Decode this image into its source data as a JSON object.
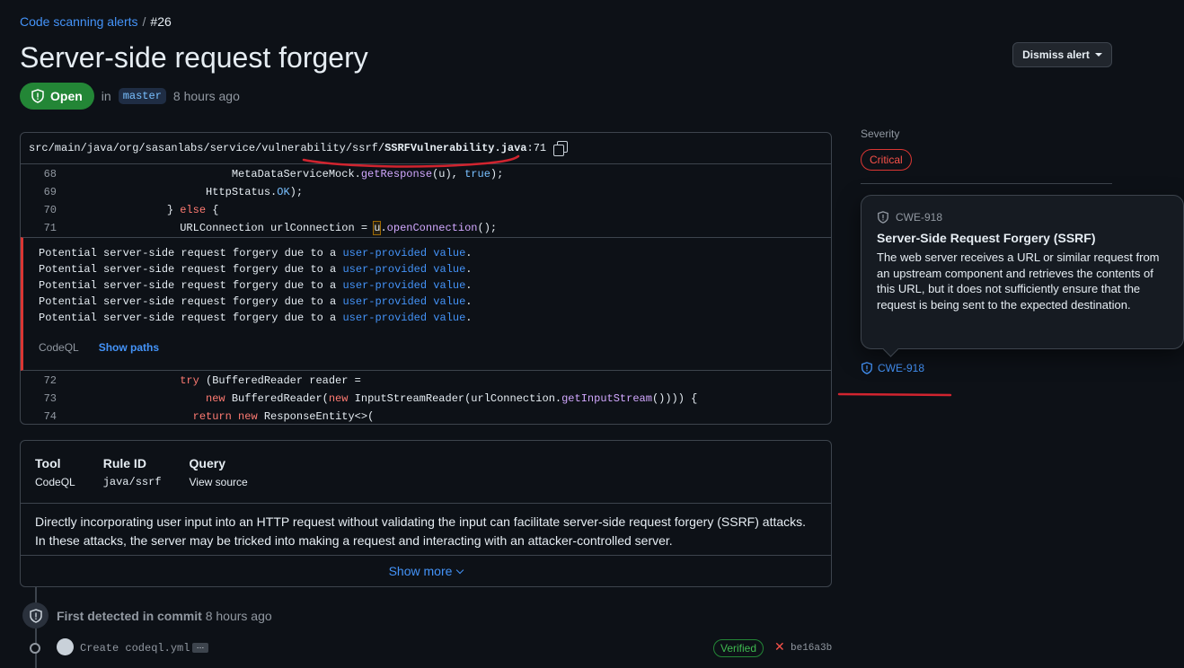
{
  "breadcrumb": {
    "link": "Code scanning alerts",
    "current": "#26"
  },
  "title": "Server-side request forgery",
  "dismiss_label": "Dismiss alert",
  "status": {
    "badge": "Open",
    "in_text": "in",
    "branch": "master",
    "time": "8 hours ago"
  },
  "file": {
    "path": "src/main/java/org/sasanlabs/service/vulnerability/ssrf/",
    "name": "SSRFVulnerability.java",
    "line": ":71"
  },
  "code_before": [
    {
      "n": "68",
      "indent": "                        ",
      "parts": [
        [
          "MetaDataServiceMock.",
          ""
        ],
        [
          "getResponse",
          "fn"
        ],
        [
          "(u), ",
          ""
        ],
        [
          "true",
          "cs"
        ],
        [
          ");",
          ""
        ]
      ]
    },
    {
      "n": "69",
      "indent": "                    ",
      "parts": [
        [
          "HttpStatus.",
          ""
        ],
        [
          "OK",
          "cs"
        ],
        [
          ");",
          ""
        ]
      ]
    },
    {
      "n": "70",
      "indent": "              ",
      "parts": [
        [
          "} ",
          ""
        ],
        [
          "else",
          "kw"
        ],
        [
          " {",
          ""
        ]
      ]
    },
    {
      "n": "71",
      "indent": "                ",
      "parts": [
        [
          "URLConnection urlConnection = ",
          ""
        ],
        [
          "u",
          "hl"
        ],
        [
          ".",
          ""
        ],
        [
          "openConnection",
          "fn"
        ],
        [
          "();",
          ""
        ]
      ]
    }
  ],
  "messages": [
    {
      "text": "Potential server-side request forgery due to a ",
      "link": "user-provided value",
      "end": "."
    },
    {
      "text": "Potential server-side request forgery due to a ",
      "link": "user-provided value",
      "end": "."
    },
    {
      "text": "Potential server-side request forgery due to a ",
      "link": "user-provided value",
      "end": "."
    },
    {
      "text": "Potential server-side request forgery due to a ",
      "link": "user-provided value",
      "end": "."
    },
    {
      "text": "Potential server-side request forgery due to a ",
      "link": "user-provided value",
      "end": "."
    }
  ],
  "alert_footer": {
    "tool": "CodeQL",
    "show_paths": "Show paths"
  },
  "code_after": [
    {
      "n": "72",
      "indent": "                ",
      "parts": [
        [
          "try",
          "kw"
        ],
        [
          " (BufferedReader reader =",
          ""
        ]
      ]
    },
    {
      "n": "73",
      "indent": "                    ",
      "parts": [
        [
          "new",
          "kw"
        ],
        [
          " BufferedReader(",
          ""
        ],
        [
          "new",
          "kw"
        ],
        [
          " InputStreamReader(urlConnection.",
          ""
        ],
        [
          "getInputStream",
          "fn"
        ],
        [
          "()))) {",
          ""
        ]
      ]
    },
    {
      "n": "74",
      "indent": "                  ",
      "parts": [
        [
          "return",
          "kw"
        ],
        [
          " ",
          ""
        ],
        [
          "new",
          "kw"
        ],
        [
          " ResponseEntity<>(",
          ""
        ]
      ]
    }
  ],
  "info": {
    "tool_h": "Tool",
    "tool_v": "CodeQL",
    "rule_h": "Rule ID",
    "rule_v": "java/ssrf",
    "query_h": "Query",
    "query_v": "View source",
    "description": "Directly incorporating user input into an HTTP request without validating the input can facilitate server-side request forgery (SSRF) attacks. In these attacks, the server may be tricked into making a request and interacting with an attacker-controlled server.",
    "show_more": "Show more"
  },
  "timeline": {
    "first_detected_bold": "First detected in commit",
    "first_detected_time": "8 hours ago",
    "commit_msg": "Create codeql.yml",
    "ellipsis": "…",
    "verified": "Verified",
    "sha": "be16a3b"
  },
  "sidebar": {
    "severity_label": "Severity",
    "severity": "Critical",
    "cwe": "CWE-918"
  },
  "tooltip": {
    "cwe": "CWE-918",
    "title": "Server-Side Request Forgery (SSRF)",
    "body": "The web server receives a URL or similar request from an upstream component and retrieves the contents of this URL, but it does not sufficiently ensure that the request is being sent to the expected destination."
  },
  "colors": {
    "bg": "#0d1117",
    "accent": "#4493f8",
    "open": "#238636",
    "critical": "#f85149",
    "annotation": "#d1242f"
  }
}
